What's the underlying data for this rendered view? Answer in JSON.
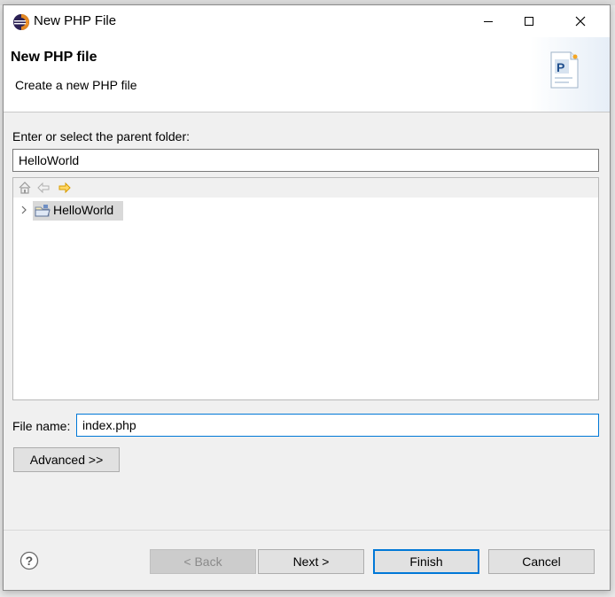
{
  "window": {
    "title": "New PHP File"
  },
  "header": {
    "title": "New PHP file",
    "description": "Create a new PHP file"
  },
  "folder": {
    "label": "Enter or select the parent folder:",
    "value": "HelloWorld"
  },
  "tree": {
    "items": [
      {
        "label": "HelloWorld",
        "selected": true,
        "expanded": false
      }
    ]
  },
  "file": {
    "label": "File name:",
    "value": "index.php"
  },
  "buttons": {
    "advanced": "Advanced >>",
    "back": "< Back",
    "next": "Next >",
    "finish": "Finish",
    "cancel": "Cancel"
  },
  "colors": {
    "focus_border": "#0078d7",
    "selection_bg": "#d9d9d9",
    "disabled_text": "#8a8a8a"
  }
}
